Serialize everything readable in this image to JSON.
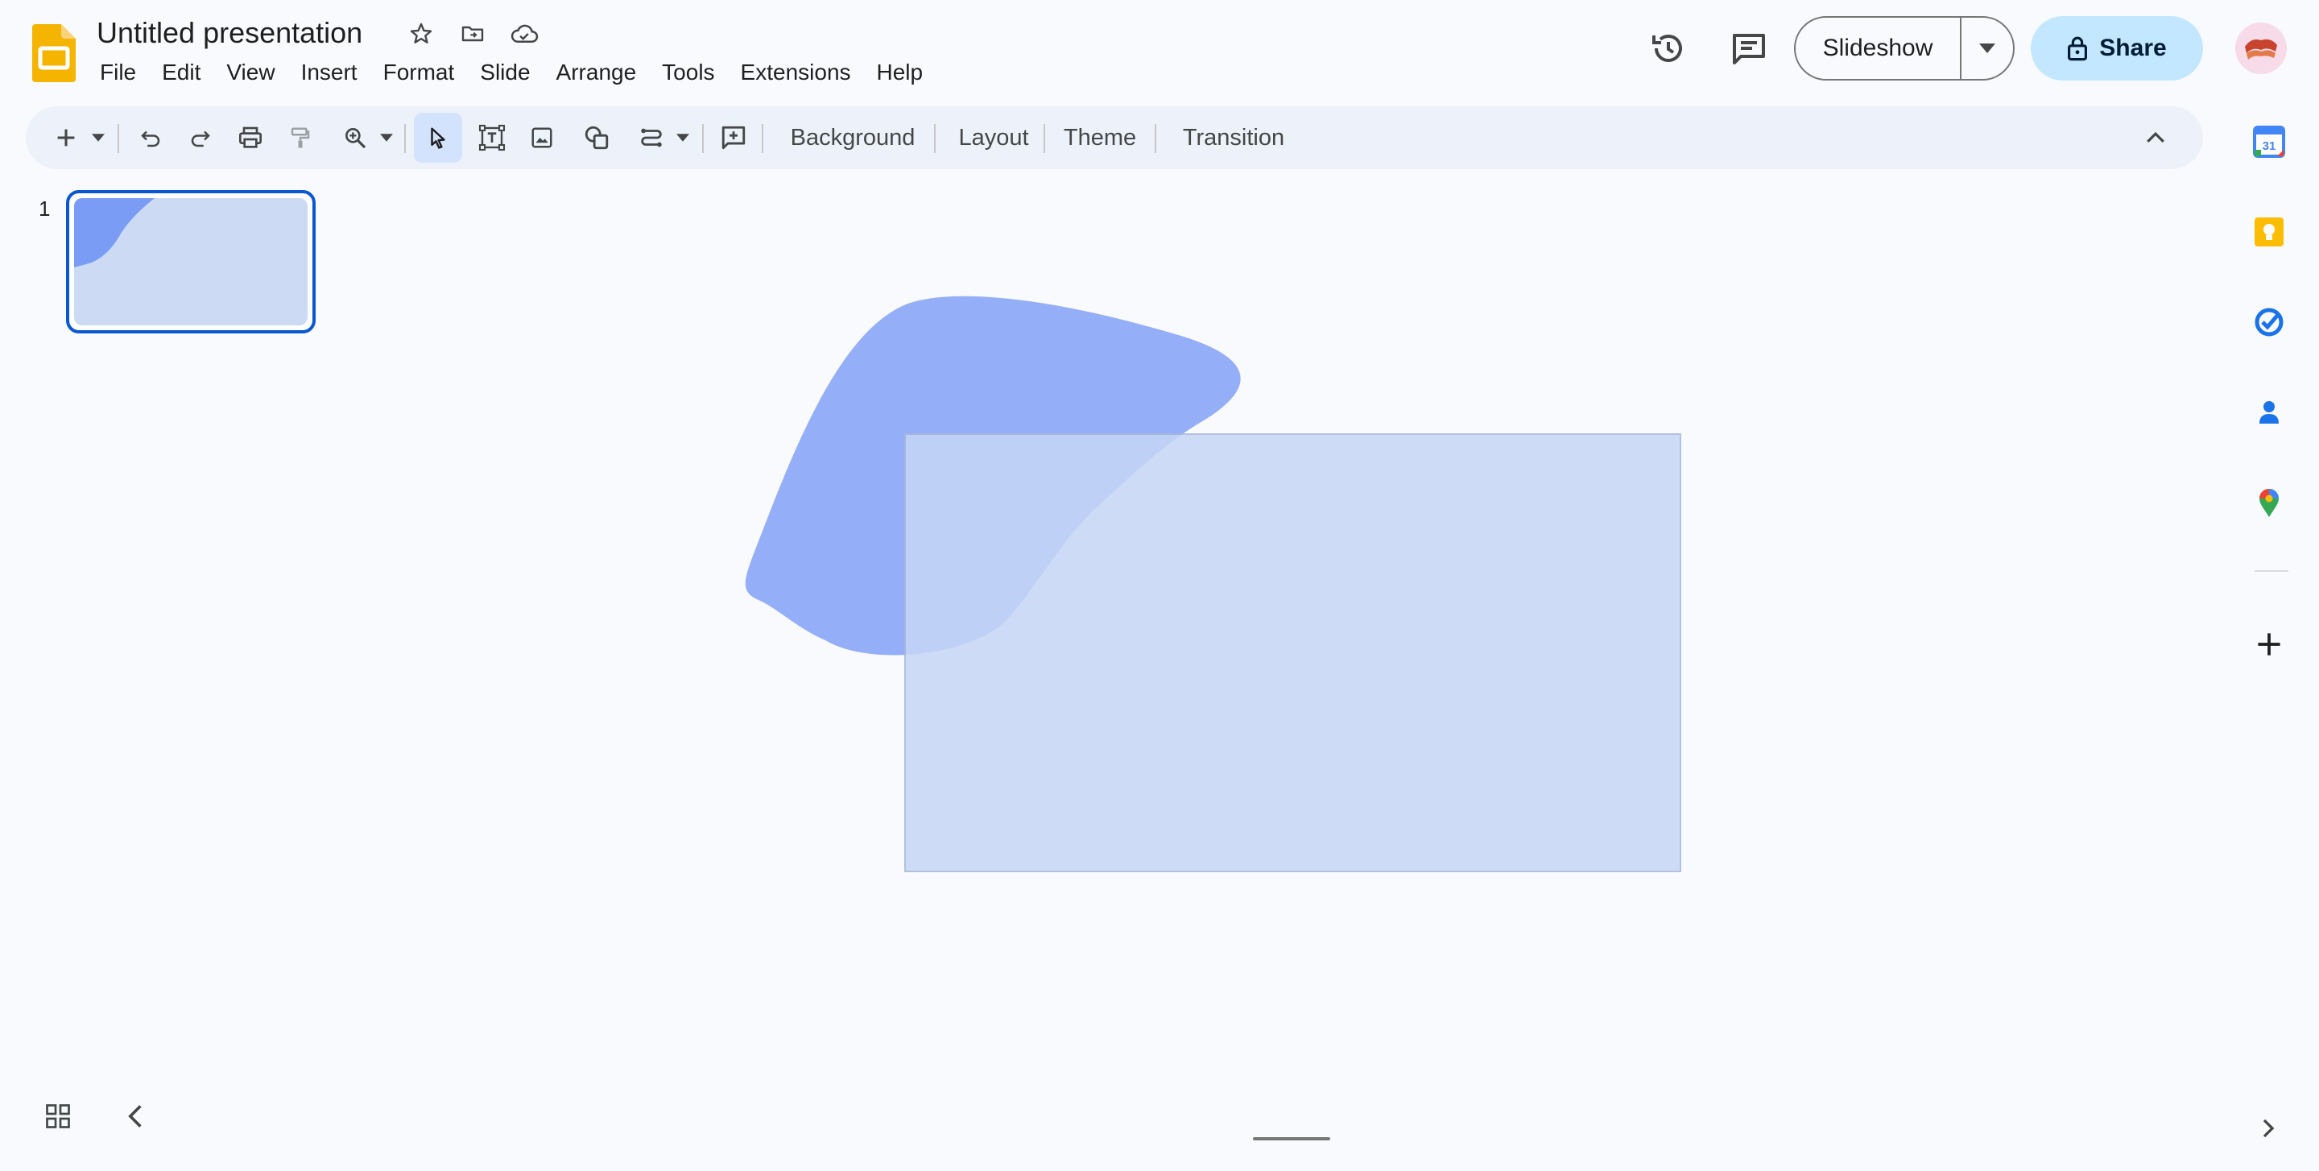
{
  "app": {
    "title": "Untitled presentation",
    "logo_icon": "slides-logo-icon",
    "colors": {
      "logo": "#f4b400",
      "accent": "#0b57d0",
      "share_bg": "#c2e7ff",
      "shape_blob": "#7b9cf5",
      "shape_rect": "#c6d6f5"
    }
  },
  "menu": [
    "File",
    "Edit",
    "View",
    "Insert",
    "Format",
    "Slide",
    "Arrange",
    "Tools",
    "Extensions",
    "Help"
  ],
  "header": {
    "slideshow_label": "Slideshow",
    "share_label": "Share"
  },
  "toolbar": {
    "background_label": "Background",
    "layout_label": "Layout",
    "theme_label": "Theme",
    "transition_label": "Transition"
  },
  "filmstrip": {
    "slides": [
      {
        "number": "1"
      }
    ]
  },
  "side_panel": {
    "apps": [
      "calendar-icon",
      "keep-icon",
      "tasks-icon",
      "contacts-icon",
      "maps-icon",
      "add-icon"
    ],
    "calendar_day": "31"
  }
}
